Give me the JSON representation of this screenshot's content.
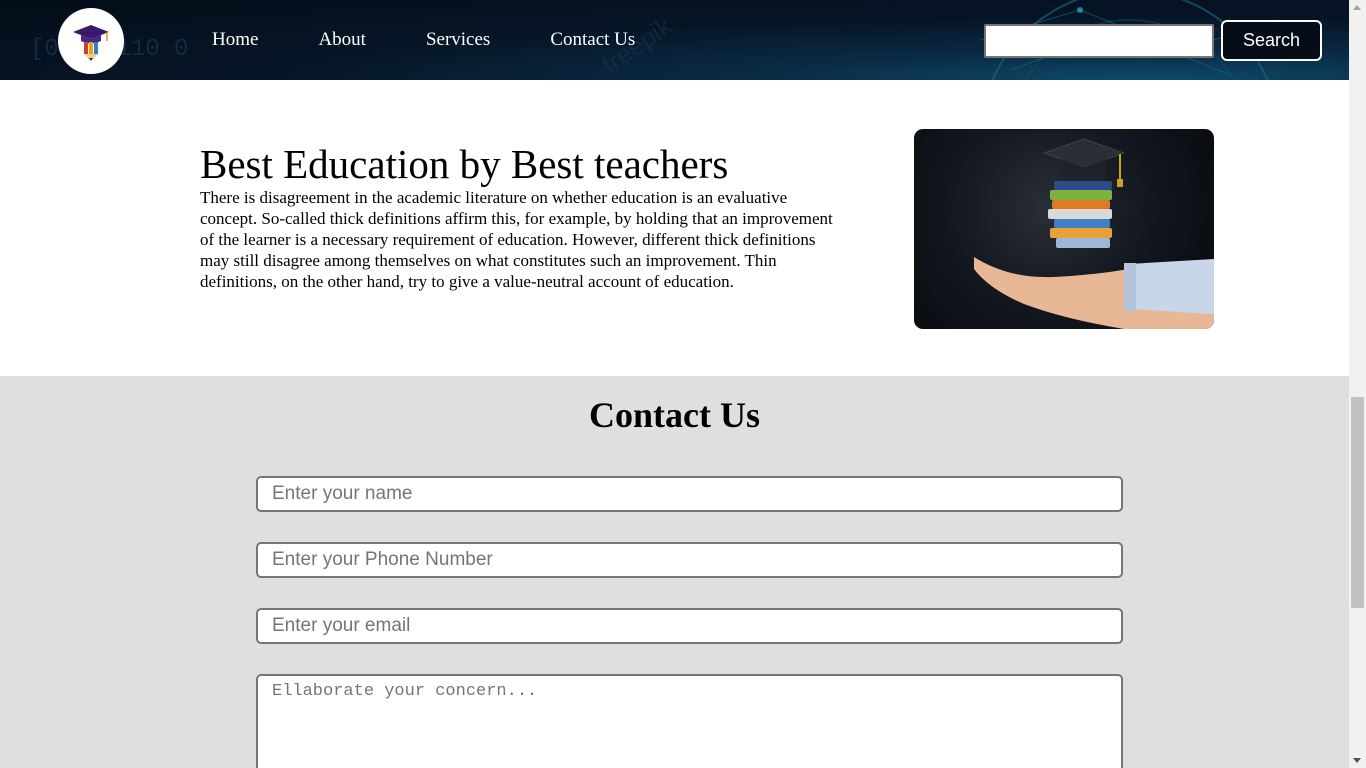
{
  "navbar": {
    "logo_icon": "graduation-cap-pencil-logo",
    "links": [
      {
        "label": "Home"
      },
      {
        "label": "About"
      },
      {
        "label": "Services"
      },
      {
        "label": "Contact Us"
      }
    ],
    "search": {
      "value": "",
      "button_label": "Search"
    },
    "background_color": "#061526"
  },
  "hero": {
    "title": "Best Education by Best teachers",
    "text": "There is disagreement in the academic literature on whether education is an evaluative concept. So-called thick definitions affirm this, for example, by holding that an improvement of the learner is a necessary requirement of education. However, different thick definitions may still disagree among themselves on what constitutes such an improvement. Thin definitions, on the other hand, try to give a value-neutral account of education.",
    "image_icon": "hand-holding-books-graduation-cap-image"
  },
  "contact": {
    "title": "Contact Us",
    "name_placeholder": "Enter your name",
    "phone_placeholder": "Enter your Phone Number",
    "email_placeholder": "Enter your email",
    "concern_placeholder": "Ellaborate your concern...",
    "background_color": "#dfdfe1"
  }
}
